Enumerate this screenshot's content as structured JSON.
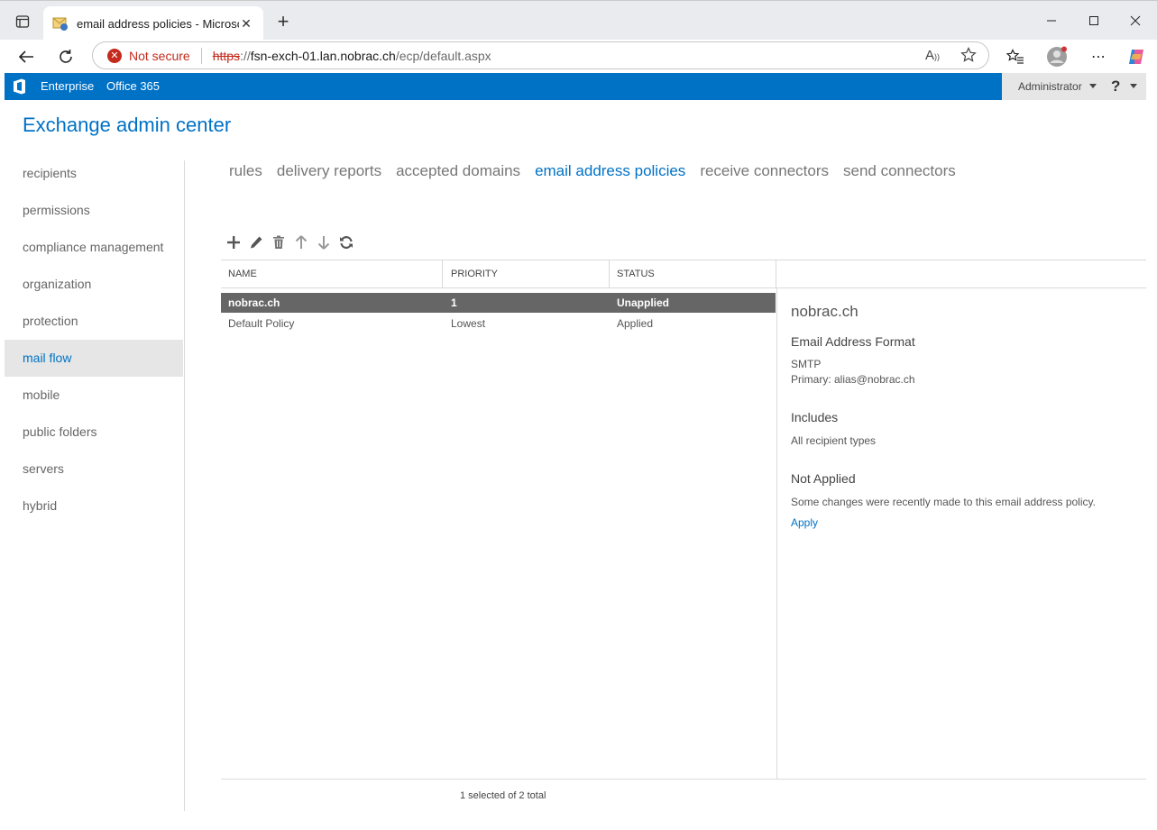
{
  "browser": {
    "tab_title": "email address policies - Microsoft",
    "security_label": "Not secure",
    "url_scheme": "https",
    "url_sep": "://",
    "url_host": "fsn-exch-01.lan.nobrac.ch",
    "url_path": "/ecp/default.aspx",
    "close_glyph": "✕",
    "new_tab_glyph": "+"
  },
  "topbar": {
    "enterprise": "Enterprise",
    "office365": "Office 365",
    "user": "Administrator",
    "help": "?"
  },
  "app": {
    "title": "Exchange admin center"
  },
  "nav": {
    "items": [
      {
        "label": "recipients"
      },
      {
        "label": "permissions"
      },
      {
        "label": "compliance management"
      },
      {
        "label": "organization"
      },
      {
        "label": "protection"
      },
      {
        "label": "mail flow",
        "active": true
      },
      {
        "label": "mobile"
      },
      {
        "label": "public folders"
      },
      {
        "label": "servers"
      },
      {
        "label": "hybrid"
      }
    ]
  },
  "subtabs": {
    "items": [
      {
        "label": "rules"
      },
      {
        "label": "delivery reports"
      },
      {
        "label": "accepted domains"
      },
      {
        "label": "email address policies",
        "active": true
      },
      {
        "label": "receive connectors"
      },
      {
        "label": "send connectors"
      }
    ]
  },
  "grid": {
    "columns": [
      "NAME",
      "PRIORITY",
      "STATUS"
    ],
    "rows": [
      {
        "name": "nobrac.ch",
        "priority": "1",
        "status": "Unapplied",
        "selected": true
      },
      {
        "name": "Default Policy",
        "priority": "Lowest",
        "status": "Applied",
        "selected": false
      }
    ],
    "footer": "1 selected of 2 total"
  },
  "details": {
    "title": "nobrac.ch",
    "format_heading": "Email Address Format",
    "format_type": "SMTP",
    "format_primary": "Primary: alias@nobrac.ch",
    "includes_heading": "Includes",
    "includes_value": "All recipient types",
    "status_heading": "Not Applied",
    "status_text": "Some changes were recently made to this email address policy.",
    "apply_link": "Apply"
  },
  "colors": {
    "brand": "#0072c6",
    "selected_row": "#666666",
    "not_secure": "#c42b1c"
  }
}
